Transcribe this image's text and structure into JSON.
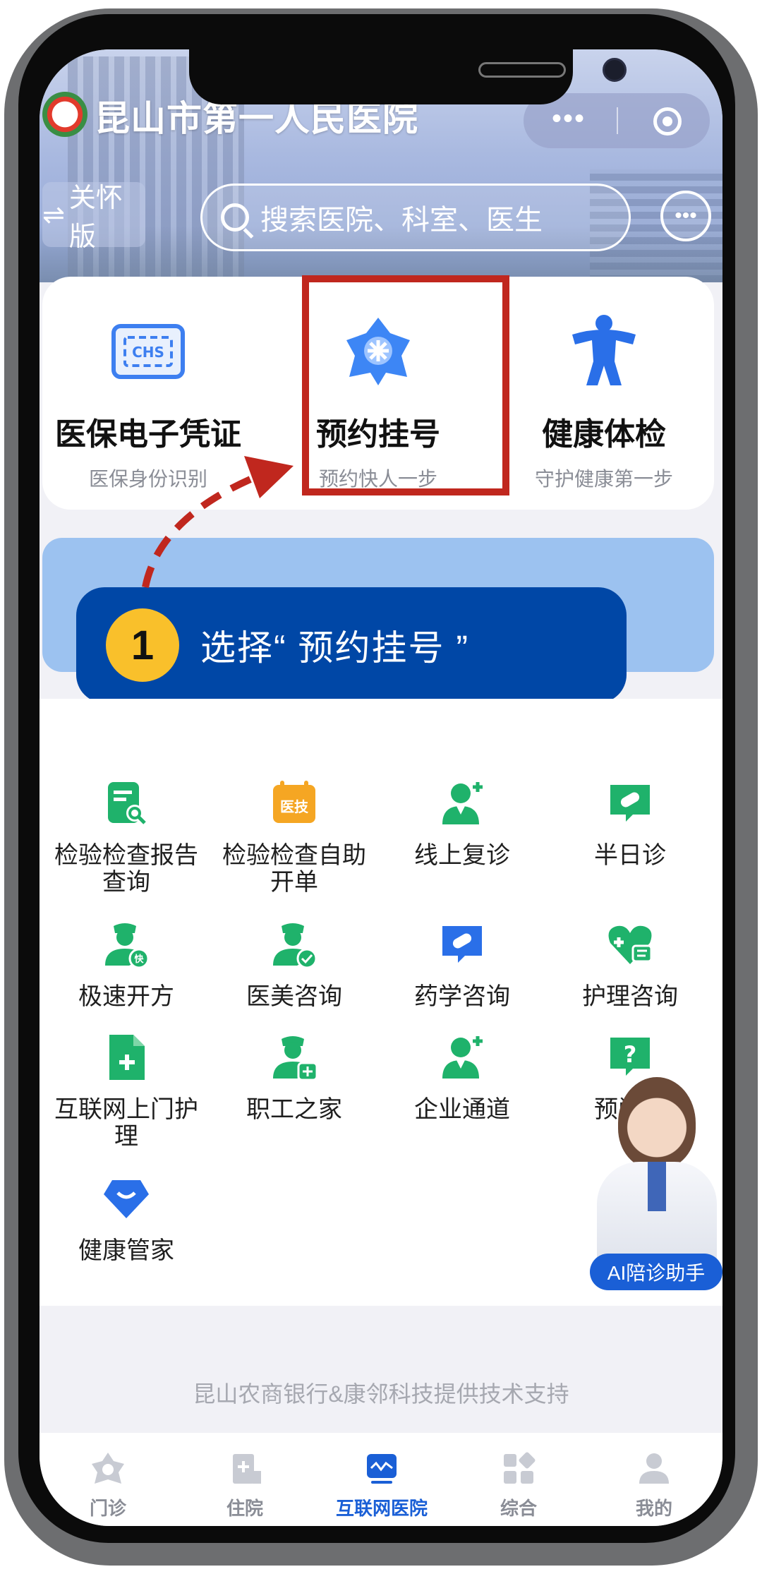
{
  "header": {
    "hospital_name": "昆山市第一人民医院",
    "care_mode_label": "关怀版",
    "search_placeholder": "搜索医院、科室、医生"
  },
  "main_services": [
    {
      "title": "医保电子凭证",
      "subtitle": "医保身份识别",
      "icon": "chs-card-icon"
    },
    {
      "title": "预约挂号",
      "subtitle": "预约快人一步",
      "icon": "medical-cross-icon"
    },
    {
      "title": "健康体检",
      "subtitle": "守护健康第一步",
      "icon": "fitness-person-icon"
    }
  ],
  "tip": {
    "step": "1",
    "text": "选择“ 预约挂号 ”"
  },
  "grid_items": [
    {
      "label": "检验检查报告查询",
      "icon": "report-search-icon"
    },
    {
      "label": "检验检查自助开单",
      "icon": "medical-tech-icon"
    },
    {
      "label": "线上复诊",
      "icon": "doctor-add-icon"
    },
    {
      "label": "半日诊",
      "icon": "pill-chat-icon"
    },
    {
      "label": "极速开方",
      "icon": "nurse-fast-icon"
    },
    {
      "label": "医美咨询",
      "icon": "nurse-check-icon"
    },
    {
      "label": "药学咨询",
      "icon": "pill-chat-icon"
    },
    {
      "label": "护理咨询",
      "icon": "heart-care-icon"
    },
    {
      "label": "互联网上门护理",
      "icon": "document-plus-icon"
    },
    {
      "label": "职工之家",
      "icon": "nurse-plus-icon"
    },
    {
      "label": "企业通道",
      "icon": "doctor-add-icon"
    },
    {
      "label": "预问诊",
      "icon": "question-chat-icon"
    },
    {
      "label": "健康管家",
      "icon": "shield-smile-icon"
    }
  ],
  "assistant_label": "AI陪诊助手",
  "footer_note": "昆山农商银行&康邻科技提供技术支持",
  "tabs": [
    {
      "label": "门诊",
      "icon": "clinic-icon",
      "active": false
    },
    {
      "label": "住院",
      "icon": "hospital-bed-icon",
      "active": false
    },
    {
      "label": "互联网医院",
      "icon": "internet-hospital-icon",
      "active": true
    },
    {
      "label": "综合",
      "icon": "apps-icon",
      "active": false
    },
    {
      "label": "我的",
      "icon": "profile-icon",
      "active": false
    }
  ],
  "colors": {
    "primary": "#1a5fd6",
    "green": "#1fb26b",
    "orange": "#f5a623",
    "highlight": "#c0271e",
    "tip_bg": "#0047a6"
  }
}
